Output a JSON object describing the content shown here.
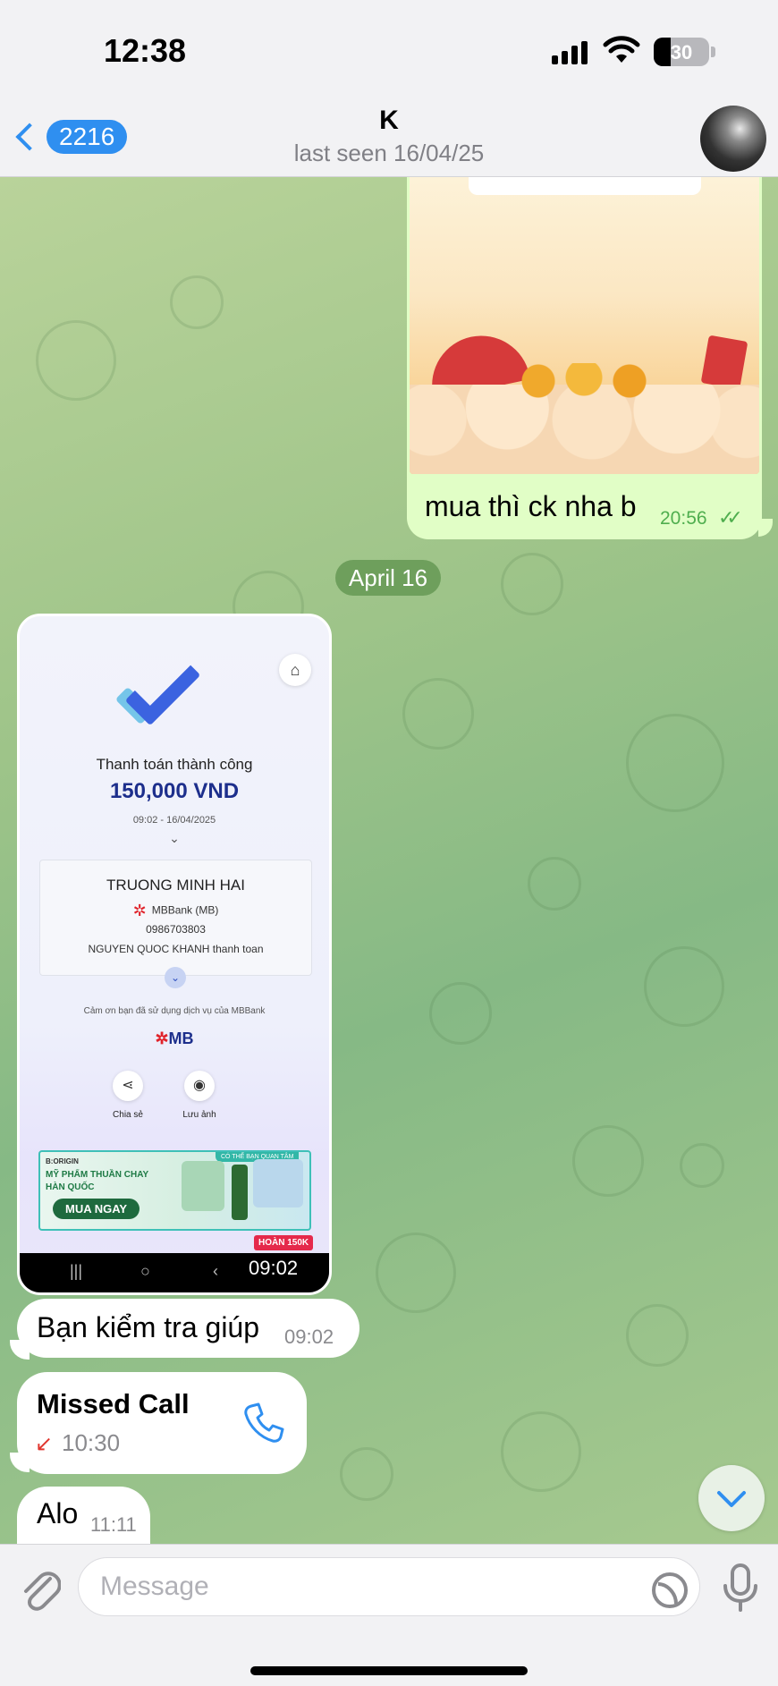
{
  "status_bar": {
    "time": "12:38",
    "battery": "30",
    "battery_level": 0.3
  },
  "header": {
    "back_badge": "2216",
    "contact_name": "K",
    "last_seen": "last seen 16/04/25"
  },
  "messages": {
    "outgoing_photo": {
      "text": "mua thì ck nha b",
      "time": "20:56",
      "status_icon": "double-check-icon"
    },
    "date_separator": "April 16",
    "incoming_photo": {
      "time": "09:02",
      "receipt": {
        "status": "Thanh toán thành công",
        "amount": "150,000 VND",
        "datetime": "09:02 - 16/04/2025",
        "recipient": "TRUONG MINH HAI",
        "bank": "MBBank (MB)",
        "account": "0986703803",
        "memo": "NGUYEN QUOC KHANH thanh toan",
        "thanks": "Cảm ơn bạn đã sử dụng dịch vụ của MBBank",
        "logo": "MB",
        "actions": [
          "Chia sẻ",
          "Lưu ảnh"
        ],
        "banner": {
          "brand": "B:ORIGIN",
          "promo": "CÓ THỂ BẠN QUAN TÂM",
          "headline1": "MỸ PHẨM THUẦN CHAY",
          "headline2": "HÀN QUỐC",
          "cta": "MUA NGAY"
        },
        "refund": "HOÀN 150K"
      }
    },
    "incoming_text_1": {
      "text": "Bạn kiểm tra giúp",
      "time": "09:02"
    },
    "missed_call": {
      "title": "Missed Call",
      "time": "10:30"
    },
    "incoming_text_2": {
      "text": "Alo",
      "time": "11:11"
    }
  },
  "composer": {
    "placeholder": "Message"
  },
  "colors": {
    "accent": "#2f8ff0",
    "outgoing_bubble": "#e1fec6",
    "date_pill": "#6e9f5c",
    "missed": "#e0362e"
  }
}
